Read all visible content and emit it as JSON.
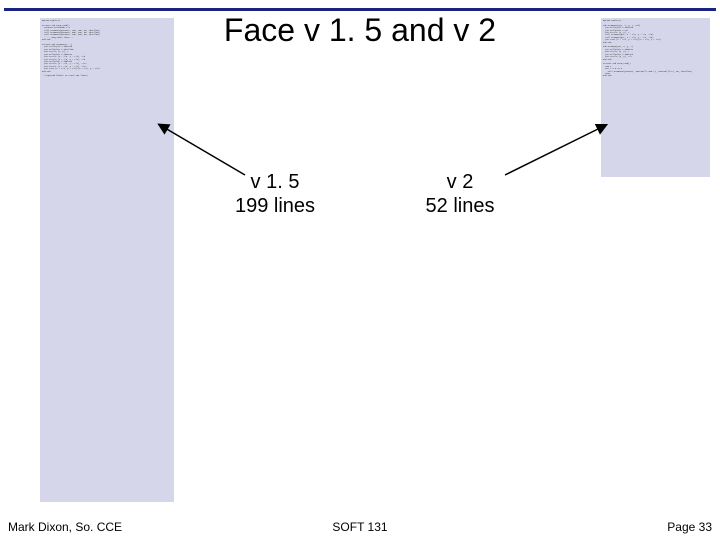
{
  "title": "Face v 1. 5 and v 2",
  "labels": {
    "left_line1": "v 1. 5",
    "left_line2": "199 lines",
    "right_line1": "v 2",
    "right_line2": "52 lines"
  },
  "footer": {
    "left": "Mark Dixon, So. CCE",
    "center": "SOFT 131",
    "right": "Page 33"
  },
  "code_left_placeholder": "Option Explicit\n\nPrivate Sub Form_Load()\n  picFace.ScaleMode = 3\n  Call DrawFace(picFace, 100, 100, 50, vbYellow)\n  Call DrawFace(picFace, 300, 100, 50, vbYellow)\n  Call DrawFace(picFace, 100, 300, 50, vbYellow)\n  ' ... many more lines ...\nEnd Sub\n\nPrivate Sub DrawFace(...)\n  pic.FillStyle = vbSolid\n  pic.FillColor = vbYellow\n  pic.Circle (x, y), r\n  pic.FillColor = vbWhite\n  pic.Circle (x - r/3, y - r/4), r/6\n  pic.Circle (x + r/3, y - r/4), r/6\n  pic.FillColor = vbBlack\n  pic.Circle (x - r/3, y - r/4), r/12\n  pic.Circle (x + r/3, y - r/4), r/12\n  pic.Line (x - r/3, y + r/3)-(x + r/3, y + r/3)\nEnd Sub\n\n' (repeated blocks to reach 199 lines)\n",
  "code_right_placeholder": "Option Explicit\n\nSub DrawFace(pic, x, y, r, col)\n  pic.FillStyle = vbSolid\n  pic.FillColor = col\n  pic.Circle (x, y), r\n  Call DrawEye(pic, x - r/3, y - r/4, r/6)\n  Call DrawEye(pic, x + r/3, y - r/4, r/6)\n  pic.Line (x - r/3, y + r/3)-(x + r/3, y + r/3)\nEnd Sub\n\nSub DrawEye(pic, x, y, r)\n  pic.FillColor = vbWhite\n  pic.Circle (x, y), r\n  pic.FillColor = vbBlack\n  pic.Circle (x, y), r/2\nEnd Sub\n\nPrivate Sub Form_Load()\n  Dim i\n  For i = 0 To 3\n    Call DrawFace(picFace, 100+200*(i Mod 2), 100+200*(i\\2), 50, vbYellow)\n  Next\nEnd Sub\n"
}
